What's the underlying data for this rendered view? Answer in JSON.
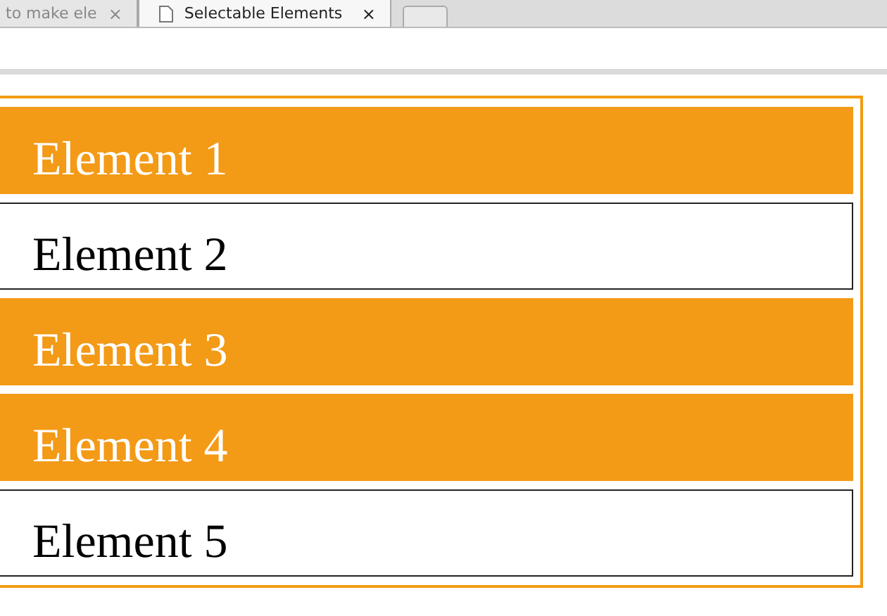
{
  "tabs": [
    {
      "label": "to make ele",
      "close": "×",
      "selected": false
    },
    {
      "label": "Selectable Elements",
      "close": "×",
      "selected": true
    }
  ],
  "items": [
    {
      "label": "Element 1",
      "selected": true
    },
    {
      "label": "Element 2",
      "selected": false
    },
    {
      "label": "Element 3",
      "selected": true
    },
    {
      "label": "Element 4",
      "selected": true
    },
    {
      "label": "Element 5",
      "selected": false
    }
  ]
}
